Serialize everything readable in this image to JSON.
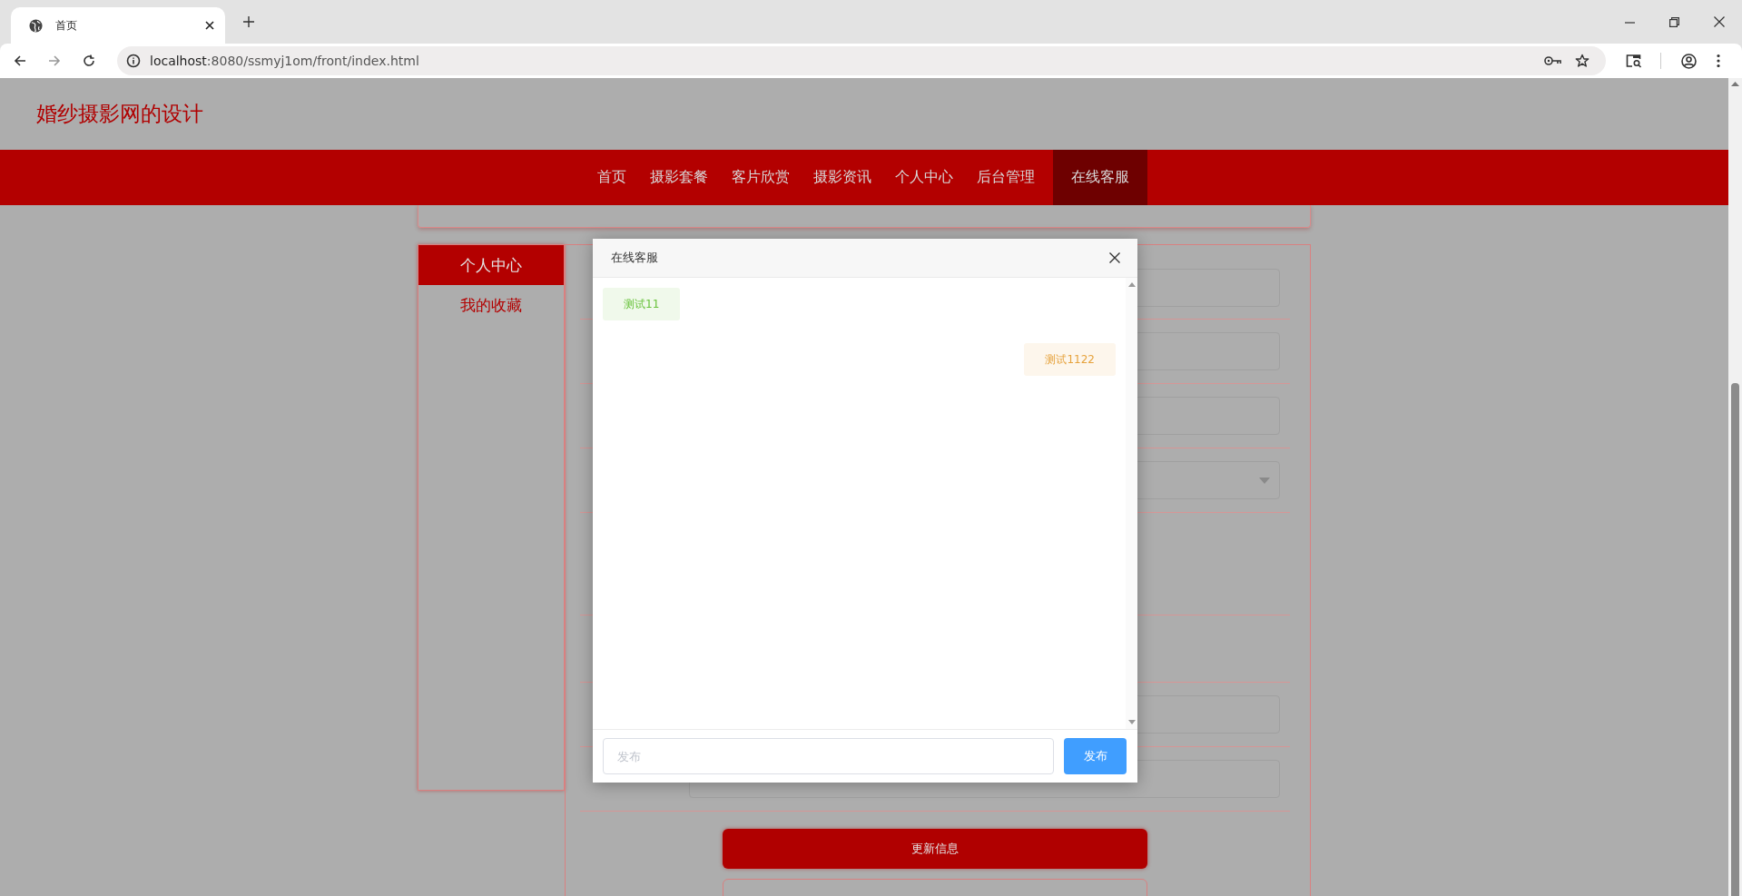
{
  "browser": {
    "tab": {
      "title": "首页"
    },
    "url": {
      "host": "localhost",
      "path": ":8080/ssmyj1om/front/index.html"
    }
  },
  "site": {
    "title": "婚纱摄影网的设计"
  },
  "nav": [
    {
      "label": "首页",
      "selected": false
    },
    {
      "label": "摄影套餐",
      "selected": false
    },
    {
      "label": "客片欣赏",
      "selected": false
    },
    {
      "label": "摄影资讯",
      "selected": false
    },
    {
      "label": "个人中心",
      "selected": false
    },
    {
      "label": "后台管理",
      "selected": false
    },
    {
      "label": "在线客服",
      "selected": true
    }
  ],
  "sidebar": [
    {
      "label": "个人中心",
      "selected": true
    },
    {
      "label": "我的收藏",
      "selected": false
    }
  ],
  "form": {
    "rows": [
      {
        "kind": "input"
      },
      {
        "kind": "input"
      },
      {
        "kind": "input"
      },
      {
        "kind": "select"
      },
      {
        "kind": "tall"
      },
      {
        "kind": "blank"
      },
      {
        "kind": "input"
      },
      {
        "kind": "input"
      }
    ],
    "buttons": [
      {
        "kind": "primary",
        "label": "更新信息"
      },
      {
        "kind": "outline"
      }
    ]
  },
  "dialog": {
    "title": "在线客服",
    "messages": [
      {
        "kind": "other",
        "text": "测试11"
      },
      {
        "kind": "self",
        "text": "测试1122"
      }
    ],
    "input": {
      "placeholder": "发布"
    },
    "send_button": "发布"
  }
}
